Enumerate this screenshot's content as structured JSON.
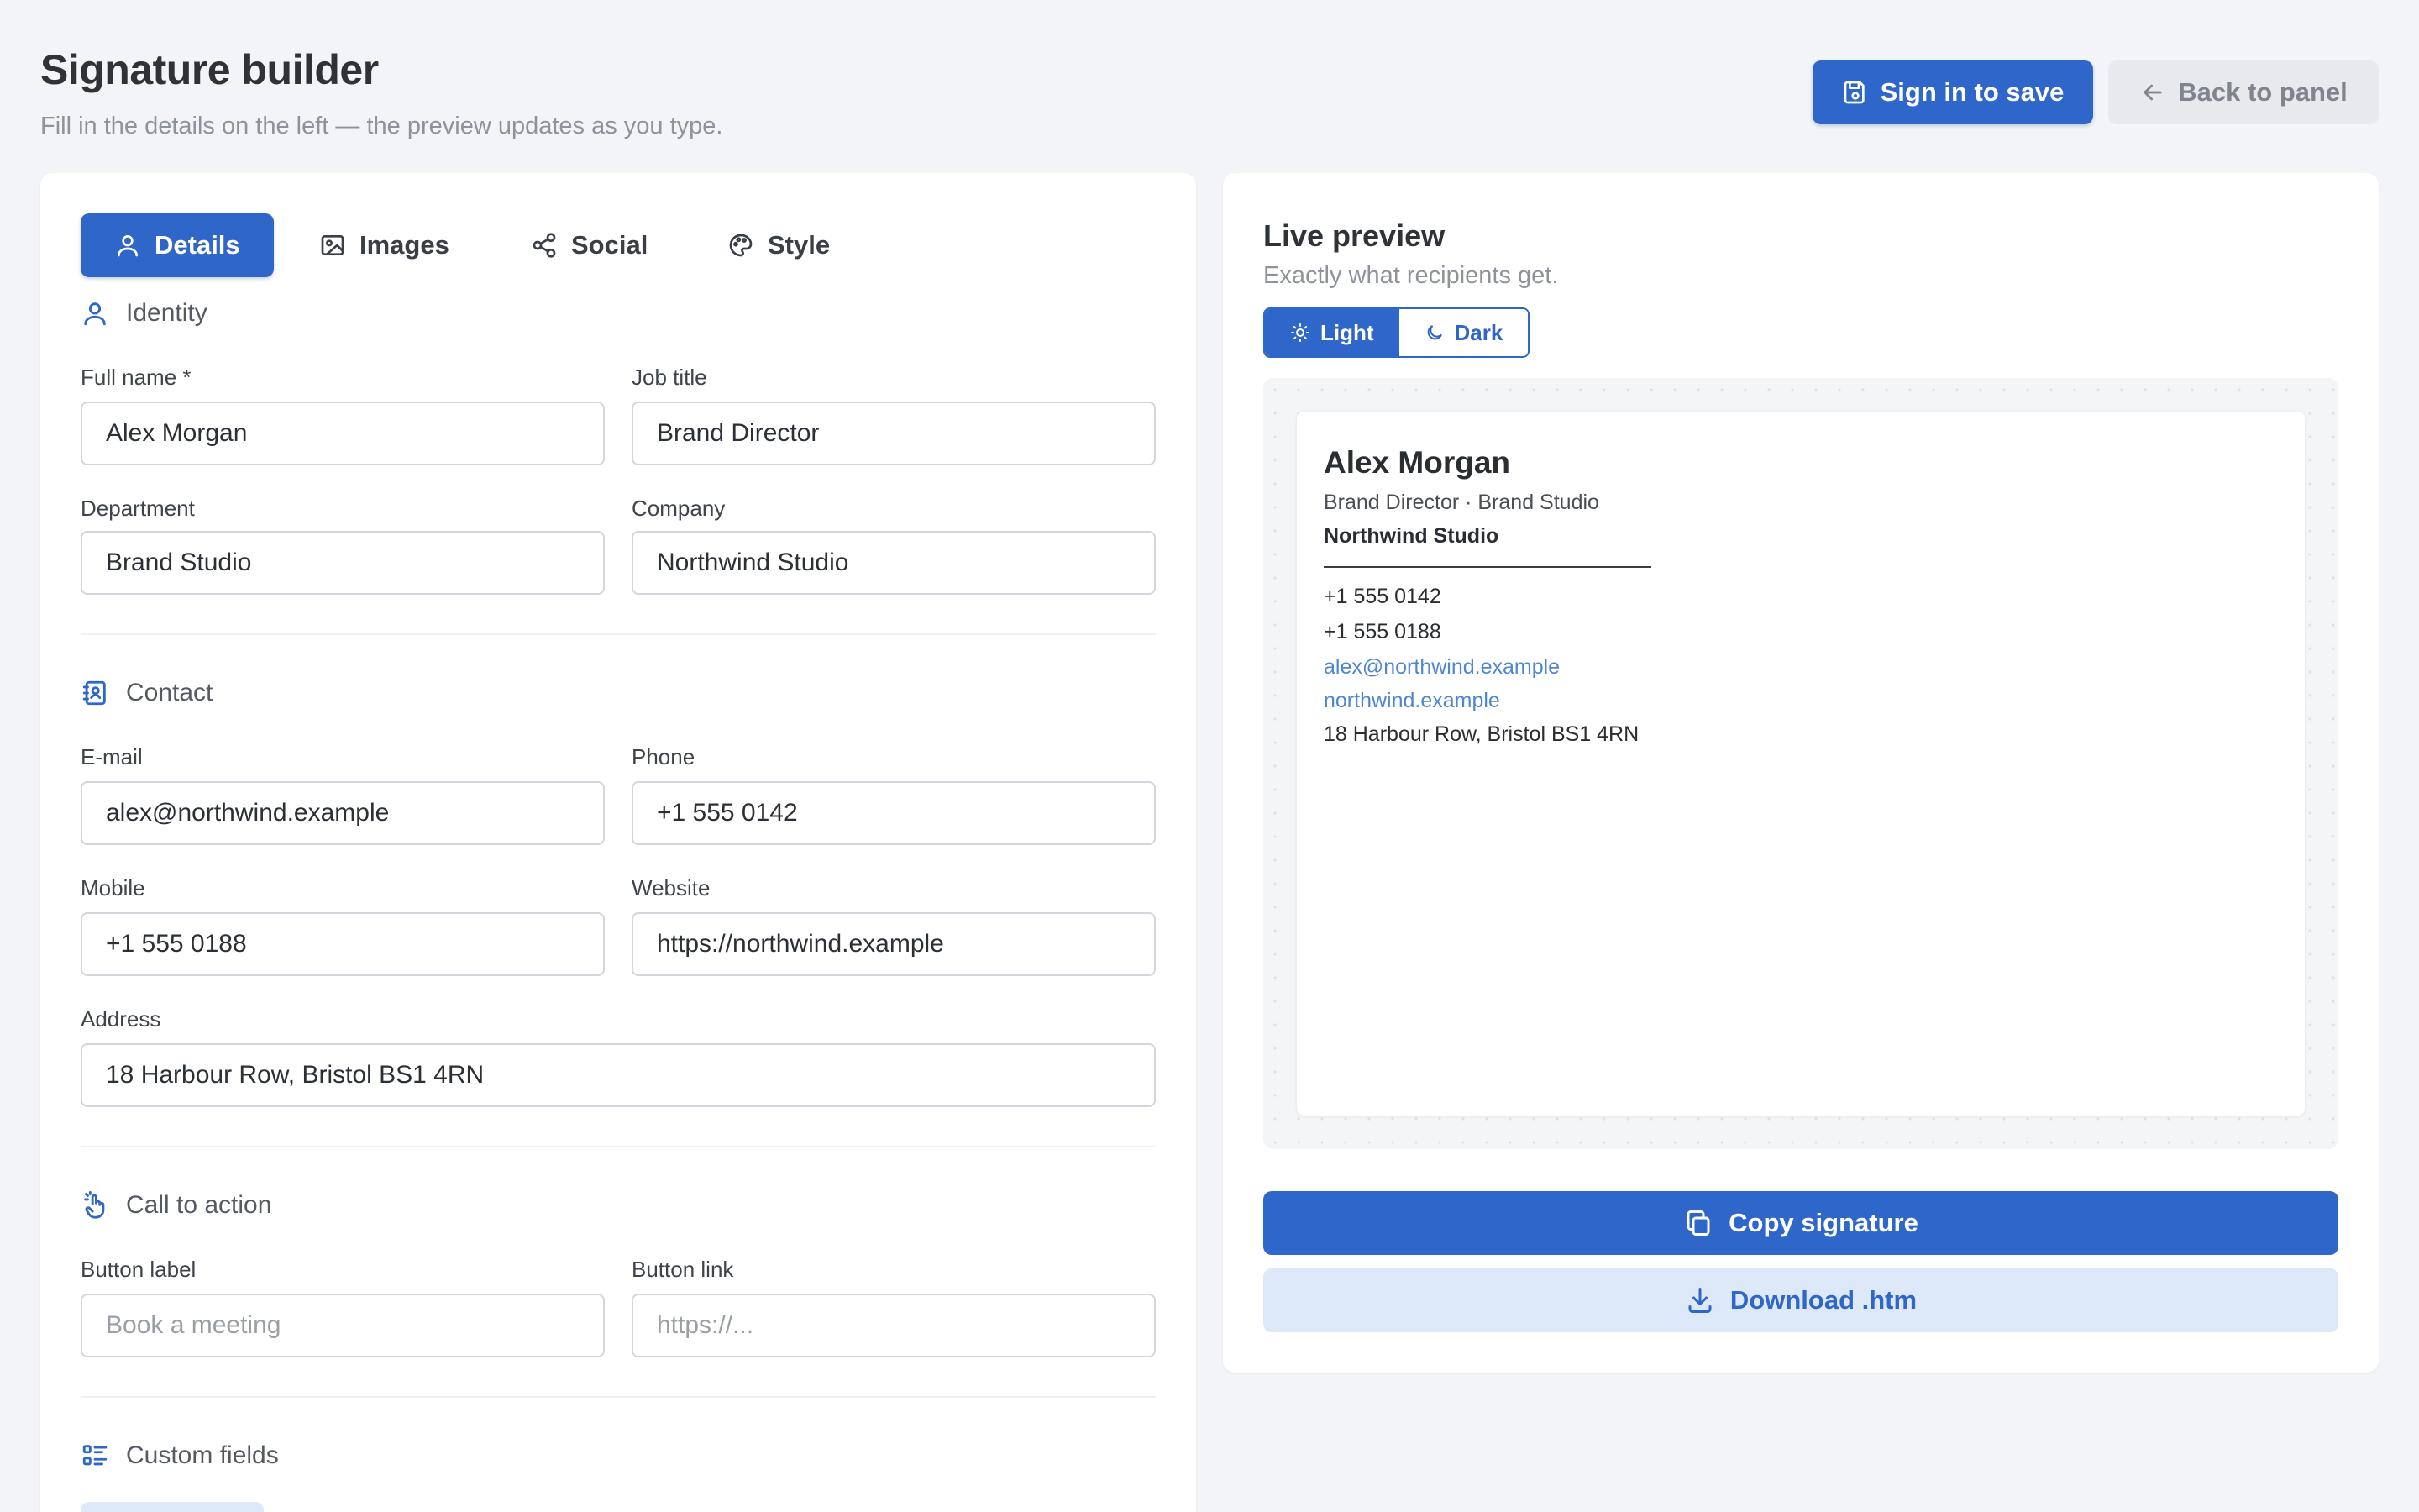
{
  "header": {
    "title": "Signature builder",
    "subtitle": "Fill in the details on the left — the preview updates as you type.",
    "save_label": "Sign in to save",
    "back_label": "Back to panel"
  },
  "tabs": [
    {
      "label": "Details",
      "icon": "user-icon",
      "active": true
    },
    {
      "label": "Images",
      "icon": "image-icon",
      "active": false
    },
    {
      "label": "Social",
      "icon": "share-icon",
      "active": false
    },
    {
      "label": "Style",
      "icon": "palette-icon",
      "active": false
    }
  ],
  "identity": {
    "heading": "Identity",
    "full_name_label": "Full name *",
    "full_name": "Alex Morgan",
    "job_title_label": "Job title",
    "job_title": "Brand Director",
    "department_label": "Department",
    "department": "Brand Studio",
    "company_label": "Company",
    "company": "Northwind Studio"
  },
  "contact": {
    "heading": "Contact",
    "email_label": "E-mail",
    "email": "alex@northwind.example",
    "phone_label": "Phone",
    "phone": "+1 555 0142",
    "mobile_label": "Mobile",
    "mobile": "+1 555 0188",
    "website_label": "Website",
    "website": "https://northwind.example",
    "address_label": "Address",
    "address": "18 Harbour Row, Bristol BS1 4RN"
  },
  "cta": {
    "heading": "Call to action",
    "button_label_label": "Button label",
    "button_label_placeholder": "Book a meeting",
    "button_link_label": "Button link",
    "button_link_placeholder": "https://..."
  },
  "custom_fields": {
    "heading": "Custom fields"
  },
  "preview": {
    "title": "Live preview",
    "subtitle": "Exactly what recipients get.",
    "light_label": "Light",
    "dark_label": "Dark",
    "mode": "light",
    "signature": {
      "name": "Alex Morgan",
      "role_line": "Brand Director · Brand Studio",
      "company": "Northwind Studio",
      "phone": "+1 555 0142",
      "mobile": "+1 555 0188",
      "email": "alex@northwind.example",
      "website": "northwind.example",
      "address": "18 Harbour Row, Bristol BS1 4RN"
    },
    "copy_label": "Copy signature",
    "download_label": "Download .htm"
  },
  "colors": {
    "accent": "#2f66c9",
    "accent_soft": "#dde8f8",
    "link": "#4f86d4",
    "background": "#f3f4f7"
  }
}
